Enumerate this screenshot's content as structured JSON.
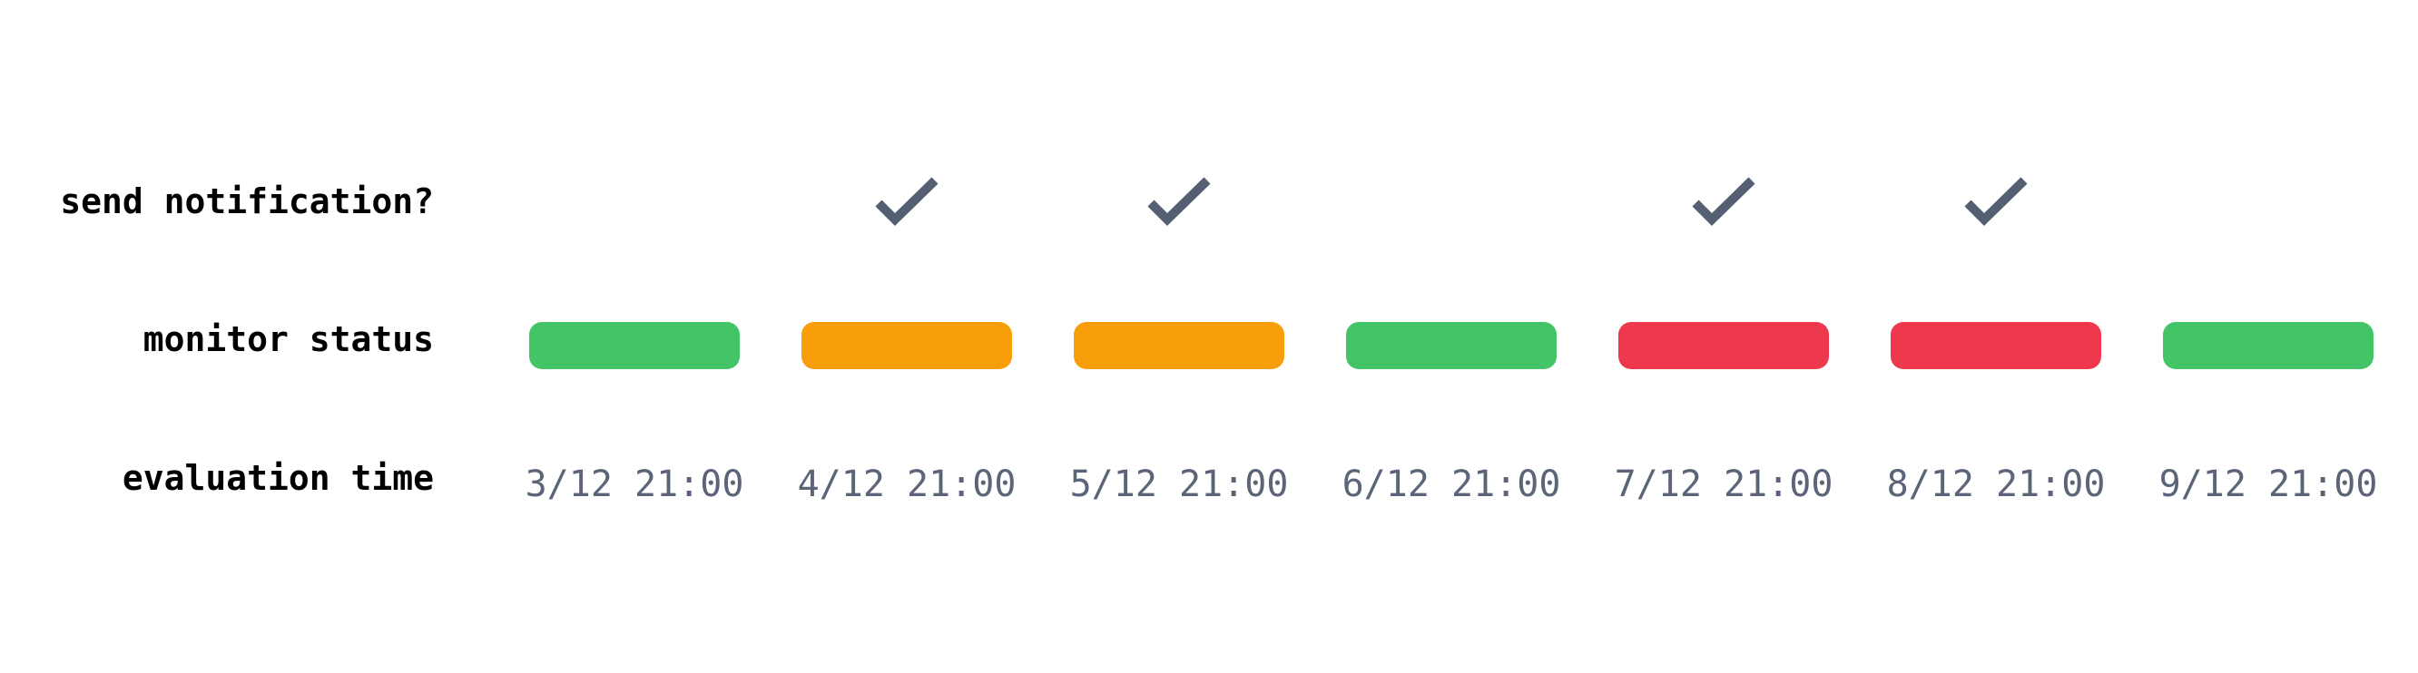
{
  "labels": {
    "notification": "send notification?",
    "status": "monitor status",
    "time": "evaluation time"
  },
  "colors": {
    "ok": "#43c467",
    "warning": "#f99e0b",
    "critical": "#ee384e",
    "check": "#555f72",
    "time_text": "#5b6478"
  },
  "evaluations": [
    {
      "time": "3/12 21:00",
      "status": "ok",
      "notify": false
    },
    {
      "time": "4/12 21:00",
      "status": "warning",
      "notify": true
    },
    {
      "time": "5/12 21:00",
      "status": "warning",
      "notify": true
    },
    {
      "time": "6/12 21:00",
      "status": "ok",
      "notify": false
    },
    {
      "time": "7/12 21:00",
      "status": "critical",
      "notify": true
    },
    {
      "time": "8/12 21:00",
      "status": "critical",
      "notify": true
    },
    {
      "time": "9/12 21:00",
      "status": "ok",
      "notify": false
    }
  ]
}
